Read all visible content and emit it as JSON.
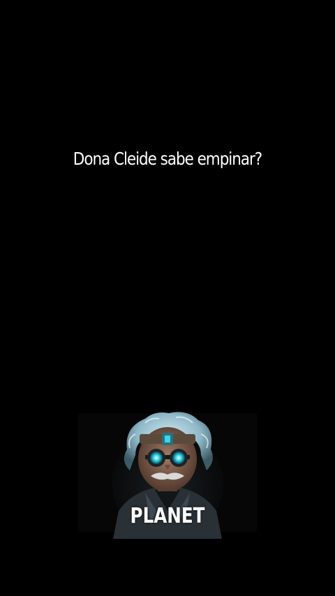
{
  "caption": {
    "text": "Dona Cleide sabe empinar?"
  },
  "logo": {
    "icon": "scientist-avatar-icon",
    "brand_text": "PLANET",
    "accent_color": "#38d6f0"
  },
  "colors": {
    "background": "#000000",
    "text": "#ffffff"
  }
}
